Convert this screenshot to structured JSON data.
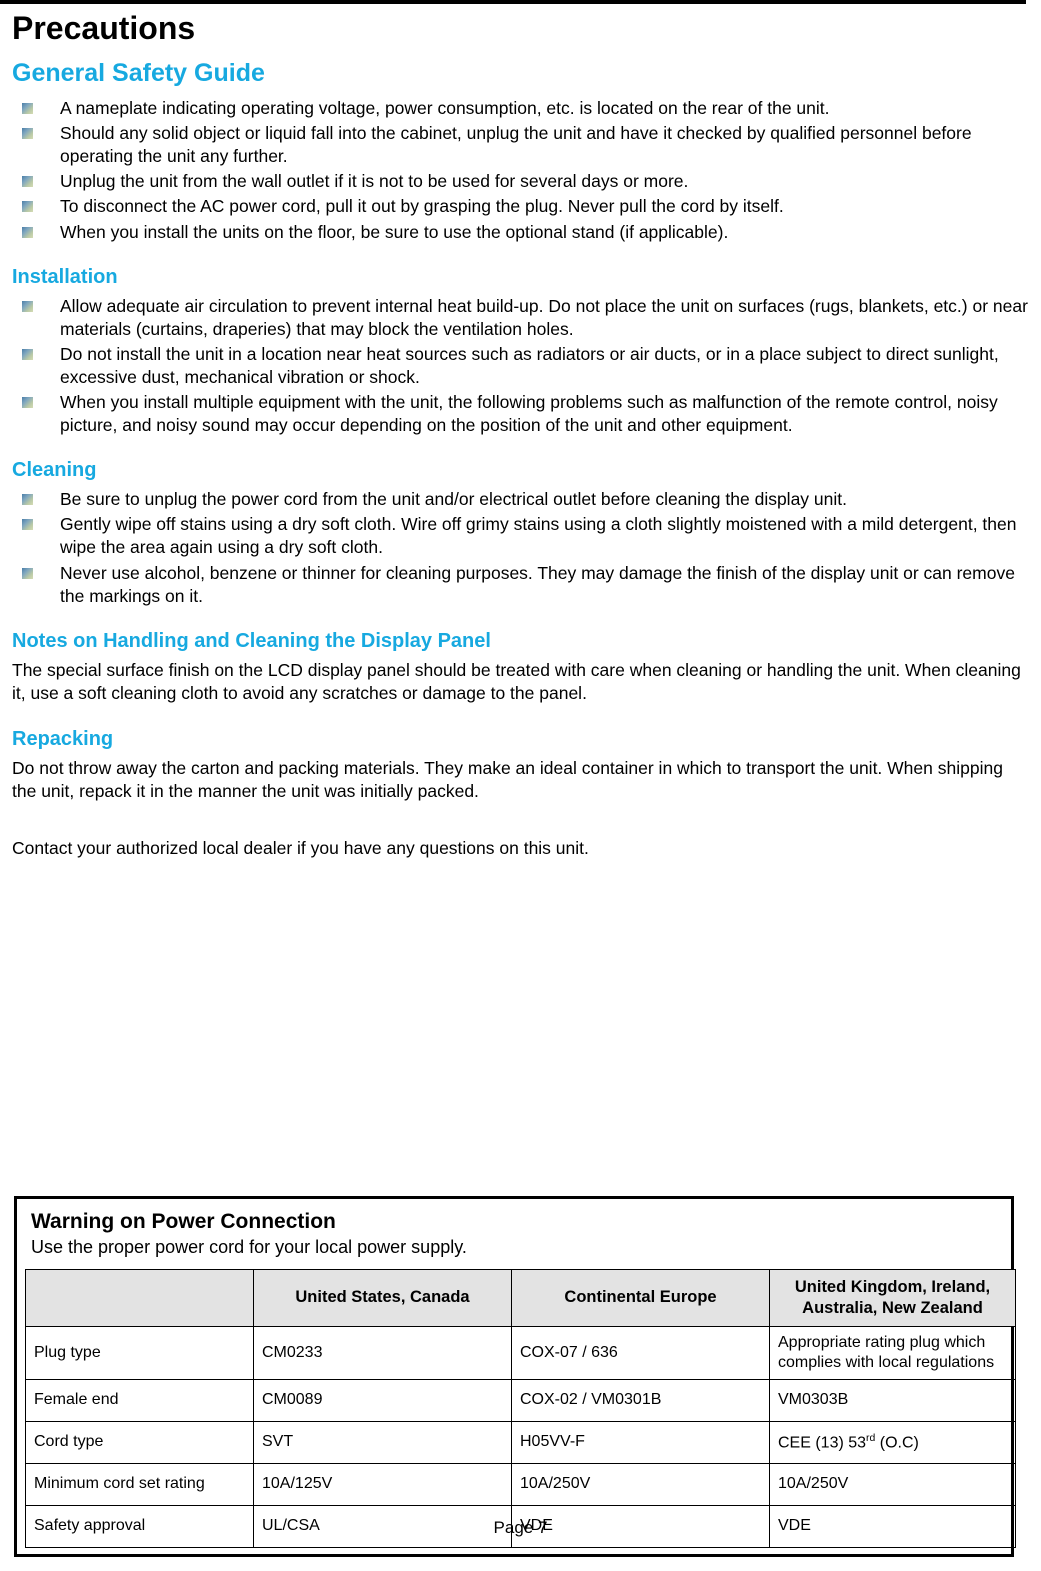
{
  "document": {
    "title": "Precautions",
    "page_footer": "Page 7",
    "accent_color": "#17A9E0",
    "bullet_icon": "gradient-square-bullet-icon"
  },
  "sections": {
    "general_safety": {
      "heading": "General Safety Guide",
      "bullets": [
        "A nameplate indicating operating voltage, power consumption, etc. is located on the rear of the unit.",
        "Should any solid object or liquid fall into the cabinet, unplug the unit and have it checked by qualified personnel before operating the unit any further.",
        "Unplug the unit from the wall outlet if it is not to be used for several days or more.",
        "To disconnect the AC power cord, pull it out by grasping the plug. Never pull the cord by itself.",
        "When you install the units on the floor, be sure to use the optional stand (if applicable)."
      ]
    },
    "installation": {
      "heading": "Installation",
      "bullets": [
        "Allow adequate air circulation to prevent internal heat build-up. Do not place the unit on surfaces (rugs, blankets, etc.) or near materials (curtains, draperies) that may block the ventilation holes.",
        "Do not install the unit in a location near heat sources such as radiators or air ducts, or in a place subject to direct sunlight, excessive dust, mechanical vibration or shock.",
        "When you install multiple equipment with the unit, the following problems such as malfunction of the remote control, noisy picture, and noisy sound may occur depending on the position of the unit and other equipment."
      ]
    },
    "cleaning": {
      "heading": "Cleaning",
      "bullets": [
        "Be sure to unplug the power cord from the unit and/or electrical outlet before cleaning the display unit.",
        "Gently wipe off stains using a dry soft cloth. Wire off grimy stains using a cloth slightly moistened with a mild detergent, then wipe the area again using a dry soft cloth.",
        "Never use alcohol, benzene or thinner for cleaning purposes. They may damage the finish of the display unit or can remove the markings on it."
      ]
    },
    "notes_panel": {
      "heading": "Notes on Handling and Cleaning the Display Panel",
      "paragraph": "The special surface finish on the LCD display panel should be treated with care when cleaning or handling the unit. When cleaning it, use a soft cleaning cloth to avoid any scratches or damage to the panel."
    },
    "repacking": {
      "heading": "Repacking",
      "paragraph": "Do not throw away the carton and packing materials. They make an ideal container in which to transport the unit. When shipping the unit, repack it in the manner the unit was initially packed."
    },
    "contact": {
      "paragraph": "Contact your authorized local dealer if you have any questions on this unit."
    }
  },
  "warning_box": {
    "title": "Warning on Power Connection",
    "subtitle": "Use the proper power cord for your local power supply.",
    "table": {
      "headers": [
        "",
        "United States, Canada",
        "Continental Europe",
        "United Kingdom, Ireland, Australia, New Zealand"
      ],
      "header_col3_line1": "United Kingdom, Ireland,",
      "header_col3_line2": "Australia, New Zealand",
      "rows": [
        {
          "label": "Plug type",
          "us_canada": "CM0233",
          "continental_europe": "COX-07 / 636",
          "uk_ireland_au_nz": "Appropriate rating plug which complies with local regulations",
          "uk_note_line1": "Appropriate rating plug which",
          "uk_note_line2": "complies with local regulations",
          "uk_is_small_note": true
        },
        {
          "label": "Female end",
          "us_canada": "CM0089",
          "continental_europe": "COX-02 / VM0301B",
          "uk_ireland_au_nz": "VM0303B",
          "uk_is_small_note": false
        },
        {
          "label": "Cord type",
          "us_canada": "SVT",
          "continental_europe": "H05VV-F",
          "uk_ireland_au_nz": "CEE (13) 53rd (O.C)",
          "uk_prefix": "CEE (13) 53",
          "uk_sup": "rd",
          "uk_suffix": " (O.C)",
          "uk_is_small_note": false
        },
        {
          "label": "Minimum cord set rating",
          "us_canada": "10A/125V",
          "continental_europe": "10A/250V",
          "uk_ireland_au_nz": "10A/250V",
          "uk_is_small_note": false
        },
        {
          "label": "Safety approval",
          "us_canada": "UL/CSA",
          "continental_europe": "VDE",
          "uk_ireland_au_nz": "VDE",
          "uk_is_small_note": false
        }
      ]
    }
  }
}
